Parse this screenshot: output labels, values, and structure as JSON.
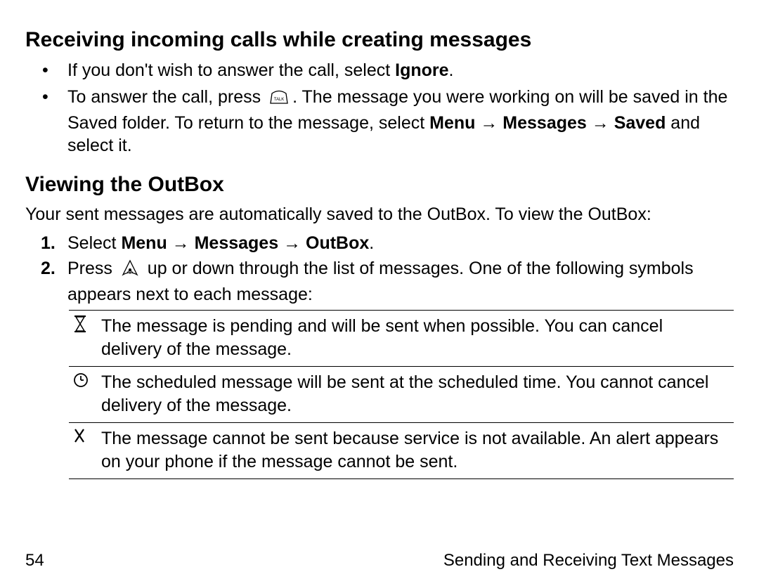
{
  "section1": {
    "title": "Receiving incoming calls while creating messages",
    "bullets": [
      {
        "pre": "If you don't wish to answer the call, select ",
        "bold1": "Ignore",
        "post": "."
      },
      {
        "pre": "To answer the call, press ",
        "icon": "talk-key-icon",
        "mid": ". The message you were working on will be saved in the Saved folder. To return to the message, select ",
        "bold1": "Menu → Messages → Saved",
        "post": " and select it."
      }
    ]
  },
  "section2": {
    "title": "Viewing the OutBox",
    "intro": "Your sent messages are automatically saved to the OutBox. To view the OutBox:",
    "steps": [
      {
        "pre": "Select ",
        "bold1": "Menu → Messages → OutBox",
        "post": "."
      },
      {
        "pre": "Press ",
        "icon": "navigation-key-icon",
        "post": " up or down through the list of messages. One of the following symbols appears next to each message:"
      }
    ],
    "symbols": [
      {
        "icon": "hourglass-icon",
        "text": "The message is pending and will be sent when possible. You can cancel delivery of the message."
      },
      {
        "icon": "clock-icon",
        "text": "The scheduled message will be sent at the scheduled time. You cannot cancel delivery of the message."
      },
      {
        "icon": "x-mark-icon",
        "text": "The message cannot be sent because service is not available. An alert appears on your phone if the message cannot be sent."
      }
    ]
  },
  "footer": {
    "page": "54",
    "chapter": "Sending and Receiving Text Messages"
  }
}
